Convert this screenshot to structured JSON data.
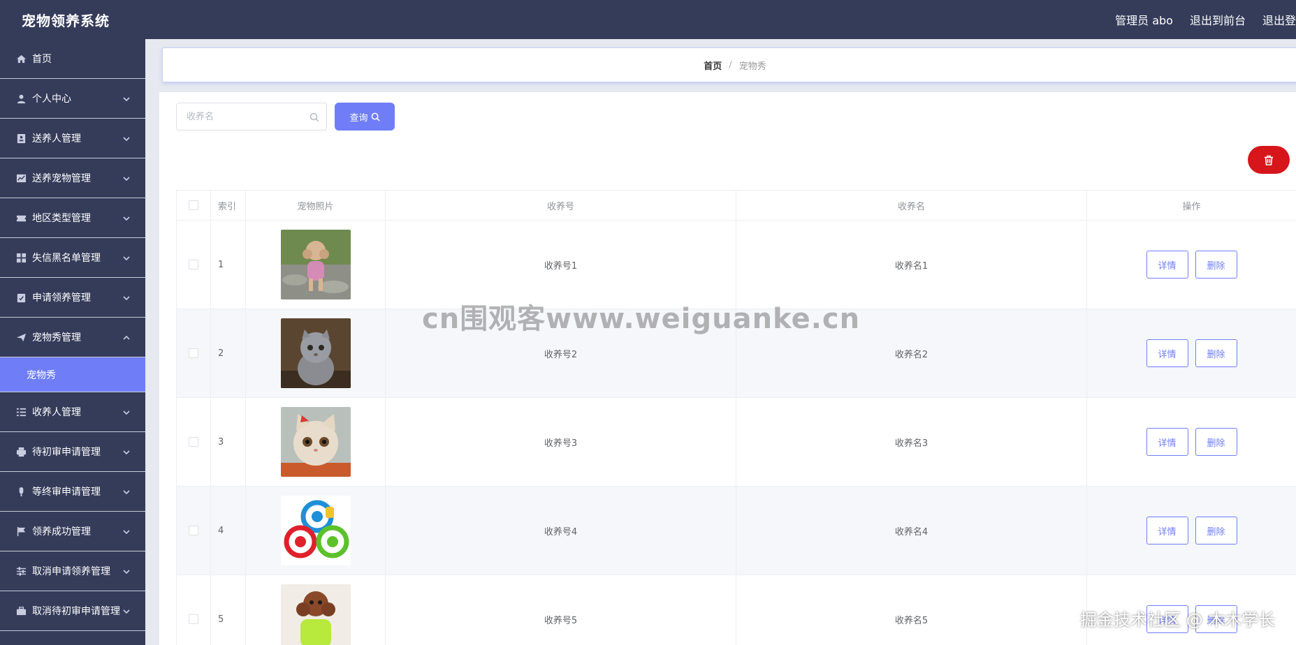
{
  "header": {
    "brand": "宠物领养系统",
    "admin_label": "管理员 abo",
    "to_front": "退出到前台",
    "logout": "退出登"
  },
  "sidebar": {
    "items": [
      {
        "label": "首页",
        "icon": "home-icon"
      },
      {
        "label": "个人中心",
        "icon": "user-icon"
      },
      {
        "label": "送养人管理",
        "icon": "contact-icon"
      },
      {
        "label": "送养宠物管理",
        "icon": "chart-icon"
      },
      {
        "label": "地区类型管理",
        "icon": "ticket-icon"
      },
      {
        "label": "失信黑名单管理",
        "icon": "grid-icon"
      },
      {
        "label": "申请领养管理",
        "icon": "clipboard-icon"
      },
      {
        "label": "宠物秀管理",
        "icon": "send-icon",
        "expanded": true
      },
      {
        "label": "收养人管理",
        "icon": "list-icon"
      },
      {
        "label": "待初审申请管理",
        "icon": "printer-icon"
      },
      {
        "label": "等终审申请管理",
        "icon": "mic-icon"
      },
      {
        "label": "领养成功管理",
        "icon": "flag-icon"
      },
      {
        "label": "取消申请领养管理",
        "icon": "sliders-icon"
      },
      {
        "label": "取消待初审申请管理",
        "icon": "briefcase-icon"
      }
    ],
    "active_sub": "宠物秀"
  },
  "breadcrumb": {
    "home": "首页",
    "sep": "/",
    "current": "宠物秀"
  },
  "search": {
    "placeholder": "收养名",
    "value": "",
    "query_label": "查询"
  },
  "table": {
    "headers": {
      "index": "索引",
      "photo": "宠物照片",
      "no": "收养号",
      "name": "收养名",
      "op": "操作"
    },
    "detail_label": "详情",
    "delete_label": "删除",
    "rows": [
      {
        "index": "1",
        "no": "收养号1",
        "name": "收养名1",
        "photo": "poodle-dog-image"
      },
      {
        "index": "2",
        "no": "收养号2",
        "name": "收养名2",
        "photo": "grey-kitten-image"
      },
      {
        "index": "3",
        "no": "收养号3",
        "name": "收养名3",
        "photo": "cream-kitten-image"
      },
      {
        "index": "4",
        "no": "收养号4",
        "name": "收养名4",
        "photo": "pet-toy-balls-image"
      },
      {
        "index": "5",
        "no": "收养号5",
        "name": "收养名5",
        "photo": "brown-poodle-image"
      }
    ]
  },
  "watermark": {
    "center": "cn围观客www.weiguanke.cn",
    "corner": "掘金技术社区 @ 木木学长"
  },
  "colors": {
    "nav_bg": "#353c5a",
    "accent": "#6f7ef7",
    "danger": "#d6161b"
  }
}
